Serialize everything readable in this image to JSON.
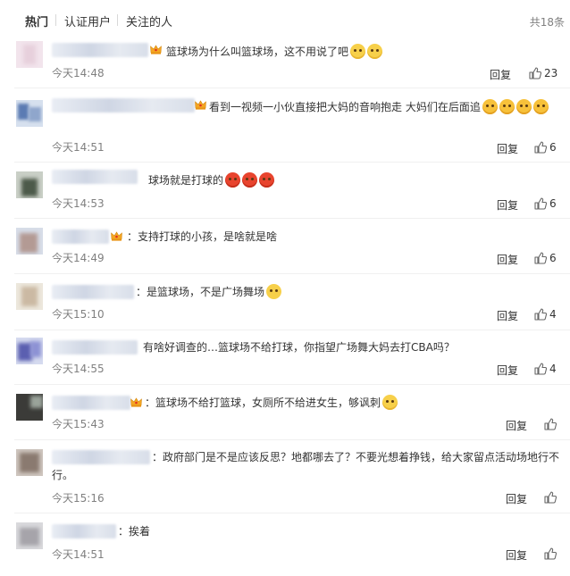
{
  "tabs": {
    "hot": "热门",
    "verified": "认证用户",
    "following": "关注的人"
  },
  "total_label": "共18条",
  "reply_label": "回复",
  "comments": [
    {
      "text": "篮球场为什么叫篮球场，这不用说了吧",
      "time": "今天14:48",
      "likes": "23"
    },
    {
      "text": "看到一视频一小伙直接把大妈的音响抱走 大妈们在后面追",
      "time": "今天14:51",
      "likes": "6"
    },
    {
      "text": "球场就是打球的",
      "time": "今天14:53",
      "likes": "6"
    },
    {
      "text": "支持打球的小孩，是啥就是啥",
      "time": "今天14:49",
      "likes": "6"
    },
    {
      "text": "是篮球场，不是广场舞场",
      "time": "今天15:10",
      "likes": "4"
    },
    {
      "text": "有啥好调查的…篮球场不给打球，你指望广场舞大妈去打CBA吗？",
      "time": "今天14:55",
      "likes": "4"
    },
    {
      "text": "篮球场不给打篮球，女厕所不给进女生，够讽刺",
      "time": "今天15:43",
      "likes": ""
    },
    {
      "text": "政府部门是不是应该反思？地都哪去了？不要光想着挣钱，给大家留点活动场地行不行。",
      "time": "今天15:16",
      "likes": ""
    },
    {
      "text": "挨着",
      "time": "今天14:51",
      "likes": ""
    }
  ]
}
